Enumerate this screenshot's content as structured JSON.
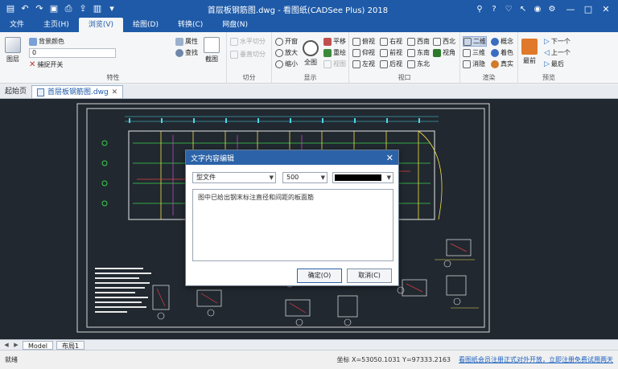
{
  "window": {
    "title": "首层板钢筋图.dwg - 看图纸(CADSee Plus) 2018",
    "controls": {
      "minimize": "—",
      "maximize": "□",
      "close": "✕"
    }
  },
  "tabs": [
    {
      "label": "文件",
      "active": false
    },
    {
      "label": "主页(H)",
      "active": false
    },
    {
      "label": "浏览(V)",
      "active": true
    },
    {
      "label": "绘图(D)",
      "active": false
    },
    {
      "label": "转换(C)",
      "active": false
    },
    {
      "label": "网盘(N)",
      "active": false
    }
  ],
  "ribbon": {
    "properties": {
      "label": "特性",
      "layers": "图层",
      "bg_color": "背景颜色",
      "snap": "捕捉开关",
      "combo_value": "0",
      "attr": "属性",
      "find": "查找",
      "screenshot": "截图"
    },
    "split": {
      "label": "切分",
      "hsplit": "水平切分",
      "vsplit": "垂直切分"
    },
    "display": {
      "label": "显示",
      "pan_on": "开窗",
      "zoom_in": "放大",
      "zoom_out": "缩小",
      "full": "全图",
      "pan": "平移",
      "redraw": "重绘",
      "prev_view": "视图"
    },
    "view": {
      "label": "视口",
      "items": [
        "俯视",
        "右视",
        "西南",
        "西北",
        "仰视",
        "前视",
        "东南",
        "视角",
        "左视",
        "后视",
        "东北"
      ]
    },
    "render": {
      "label": "渲染",
      "two_d": "二维",
      "three_d": "三维",
      "hide": "消隐",
      "concept": "概念",
      "shade": "着色",
      "real": "真实"
    },
    "preview": {
      "label": "预览",
      "last": "最前",
      "next": "下一个",
      "prev": "上一个",
      "end": "最后"
    }
  },
  "doc_tabs": {
    "home": "起始页",
    "file": "首层板钢筋图.dwg"
  },
  "dialog": {
    "title": "文字内容编辑",
    "font": "型文件",
    "size": "500",
    "text": "图中已给出钢末标注直径和间距的板面筋",
    "ok": "确定(O)",
    "cancel": "取消(C)"
  },
  "layout_tabs": [
    "Model",
    "布局1"
  ],
  "status": {
    "ready": "就绪",
    "coords": "坐标 X=53050.1031 Y=97333.2163",
    "notice": "看图纸会员注册正式对外开放，立即注册免费试用两天"
  },
  "colors": {
    "accent": "#1e5aa8",
    "canvas_bg": "#212830",
    "cad_yellow": "#f2e04a",
    "cad_green": "#38d24a",
    "cad_cyan": "#4fd6ea",
    "cad_white": "#e8e8e8",
    "cad_red": "#e24040",
    "cad_magenta": "#d050d0"
  }
}
